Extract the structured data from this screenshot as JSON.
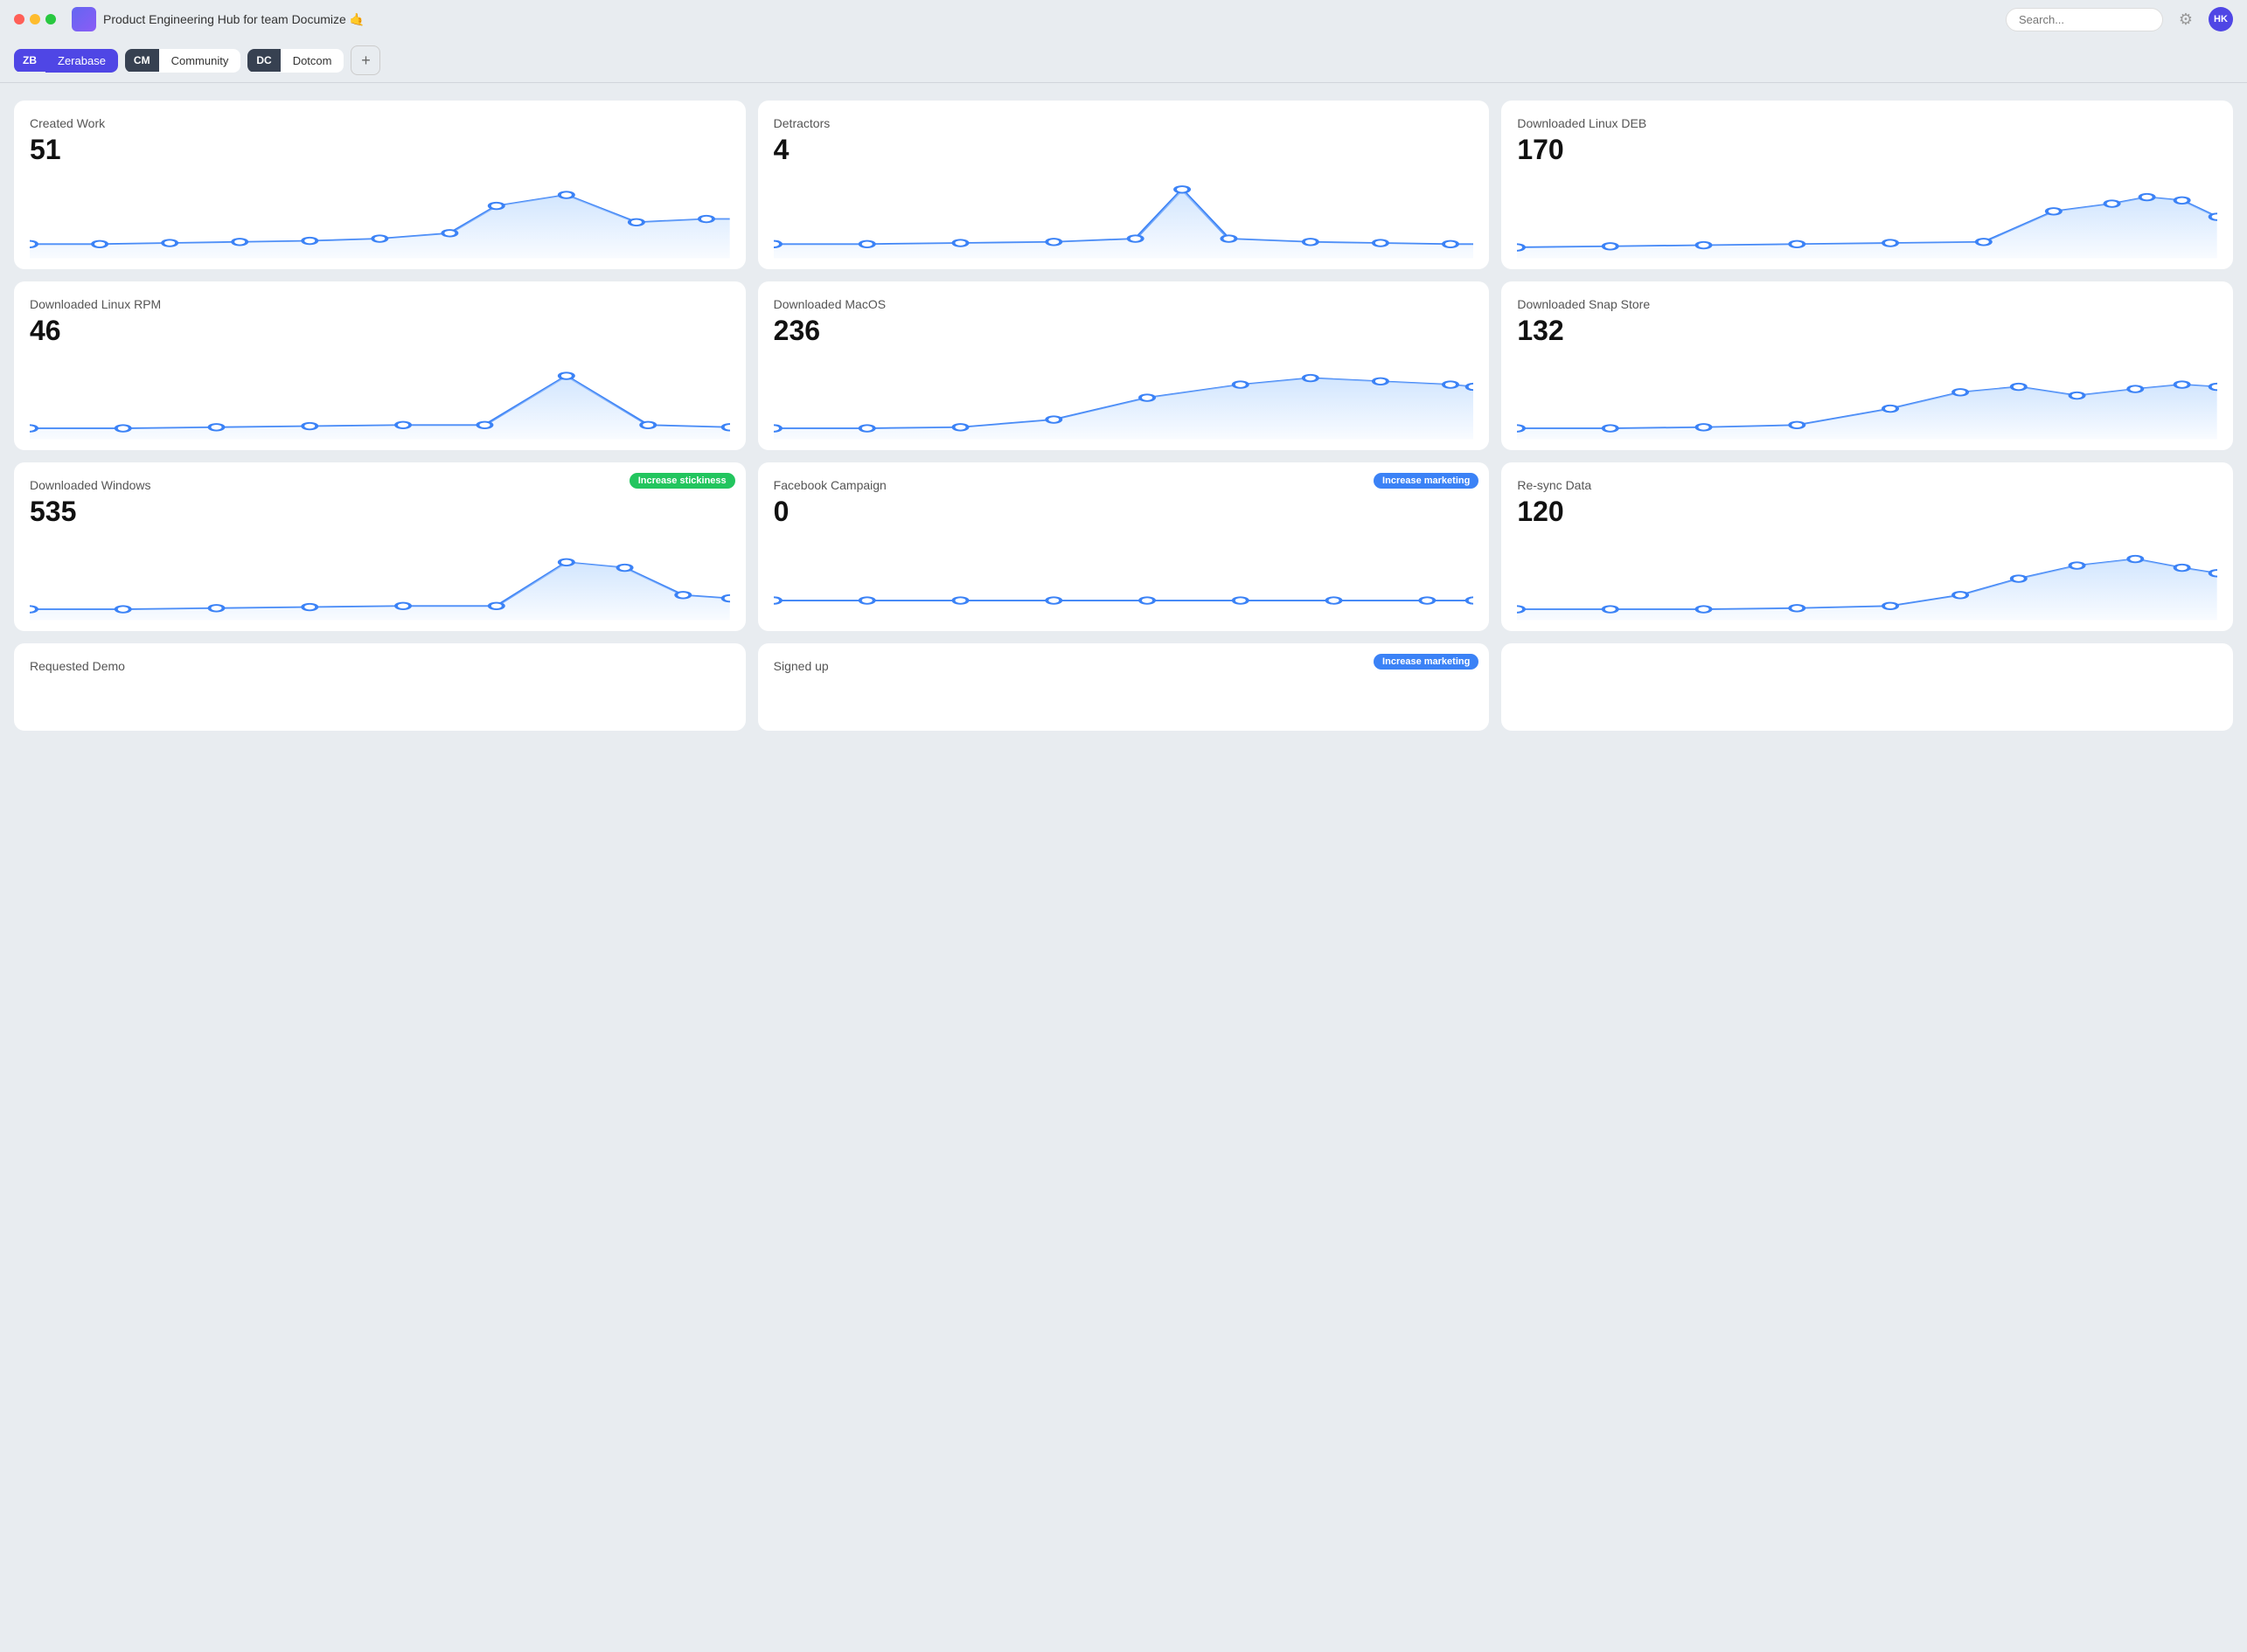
{
  "titlebar": {
    "app_title": "Product Engineering Hub for team Documize 🤙",
    "search_placeholder": "Search...",
    "avatar_initials": "HK"
  },
  "tabs": [
    {
      "id": "zb",
      "badge": "ZB",
      "label": "Zerabase",
      "active": true
    },
    {
      "id": "cm",
      "badge": "CM",
      "label": "Community",
      "active": false
    },
    {
      "id": "dc",
      "badge": "DC",
      "label": "Dotcom",
      "active": false
    }
  ],
  "cards": [
    {
      "title": "Created Work",
      "value": "51",
      "badge": null,
      "badge_type": null,
      "chart_type": "area_spike_right"
    },
    {
      "title": "Detractors",
      "value": "4",
      "badge": null,
      "badge_type": null,
      "chart_type": "area_spike_mid"
    },
    {
      "title": "Downloaded Linux DEB",
      "value": "170",
      "badge": null,
      "badge_type": null,
      "chart_type": "area_rise_right"
    },
    {
      "title": "Downloaded Linux RPM",
      "value": "46",
      "badge": null,
      "badge_type": null,
      "chart_type": "area_spike_triangle"
    },
    {
      "title": "Downloaded MacOS",
      "value": "236",
      "badge": null,
      "badge_type": null,
      "chart_type": "area_rise_smooth"
    },
    {
      "title": "Downloaded Snap Store",
      "value": "132",
      "badge": null,
      "badge_type": null,
      "chart_type": "area_rise_bumpy"
    },
    {
      "title": "Downloaded Windows",
      "value": "535",
      "badge": "Increase stickiness",
      "badge_type": "green",
      "chart_type": "area_spike_mid_right"
    },
    {
      "title": "Facebook Campaign",
      "value": "0",
      "badge": "Increase marketing",
      "badge_type": "blue",
      "chart_type": "flat_line"
    },
    {
      "title": "Re-sync Data",
      "value": "120",
      "badge": null,
      "badge_type": null,
      "chart_type": "area_rise_late"
    }
  ],
  "bottom_cards": [
    {
      "title": "Requested Demo",
      "badge": null,
      "badge_type": null
    },
    {
      "title": "Signed up",
      "badge": "Increase marketing",
      "badge_type": "blue"
    },
    {
      "title": "",
      "badge": null,
      "badge_type": null
    }
  ]
}
